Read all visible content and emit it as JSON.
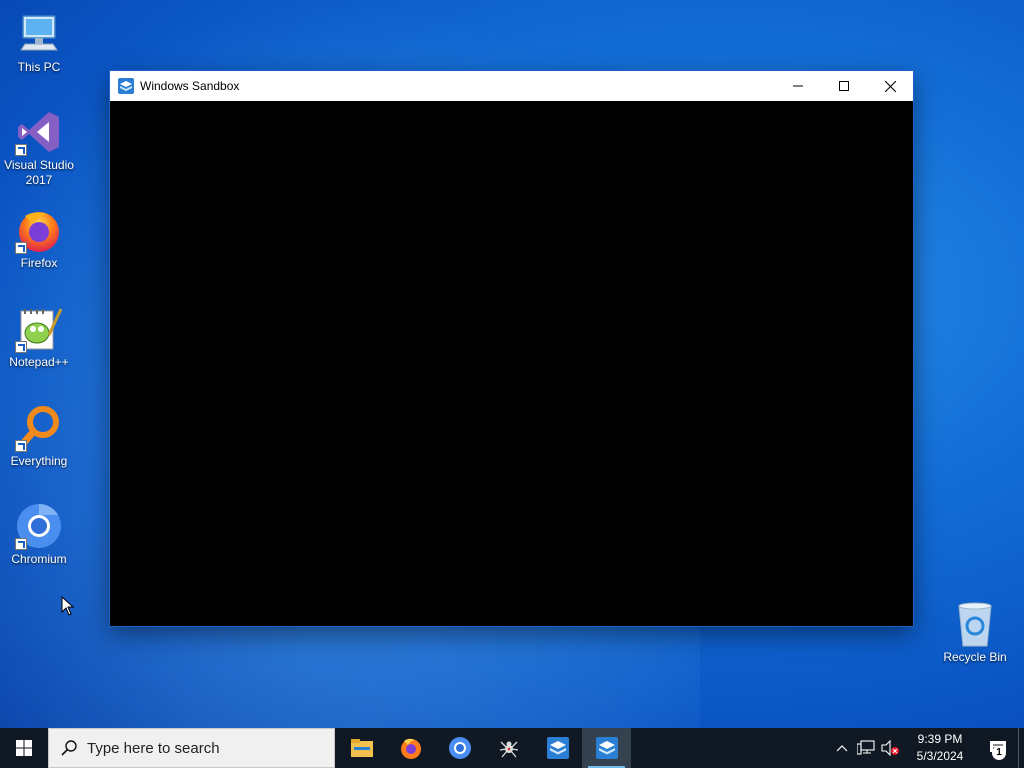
{
  "desktop": {
    "icons": [
      {
        "label": "This PC"
      },
      {
        "label": "Visual Studio 2017"
      },
      {
        "label": "Firefox"
      },
      {
        "label": "Notepad++"
      },
      {
        "label": "Everything"
      },
      {
        "label": "Chromium"
      }
    ],
    "recycle_bin": {
      "label": "Recycle Bin"
    }
  },
  "window": {
    "title": "Windows Sandbox",
    "icon": "sandbox-icon"
  },
  "taskbar": {
    "search_placeholder": "Type here to search",
    "apps": [
      "file-explorer-icon",
      "firefox-icon",
      "chromium-icon",
      "spider-icon",
      "sandbox-icon",
      "sandbox-icon"
    ],
    "clock": {
      "time": "9:39 PM",
      "date": "5/3/2024"
    },
    "notification_count": "1"
  },
  "colors": {
    "taskbar_bg": "#101923",
    "accent": "#76b9ed",
    "desktop_blue": "#0a55c4"
  }
}
